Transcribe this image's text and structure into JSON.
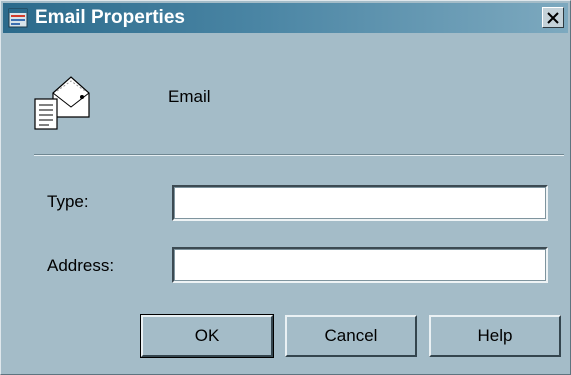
{
  "window": {
    "title": "Email Properties"
  },
  "header": {
    "label": "Email"
  },
  "form": {
    "type_label": "Type:",
    "type_value": "",
    "address_label": "Address:",
    "address_value": ""
  },
  "buttons": {
    "ok": "OK",
    "cancel": "Cancel",
    "help": "Help"
  },
  "icons": {
    "title": "properties-icon",
    "close": "close-icon",
    "header": "email-envelope-icon"
  },
  "colors": {
    "dialog_bg": "#a4bcc8",
    "titlebar": "#2b6a8b"
  }
}
